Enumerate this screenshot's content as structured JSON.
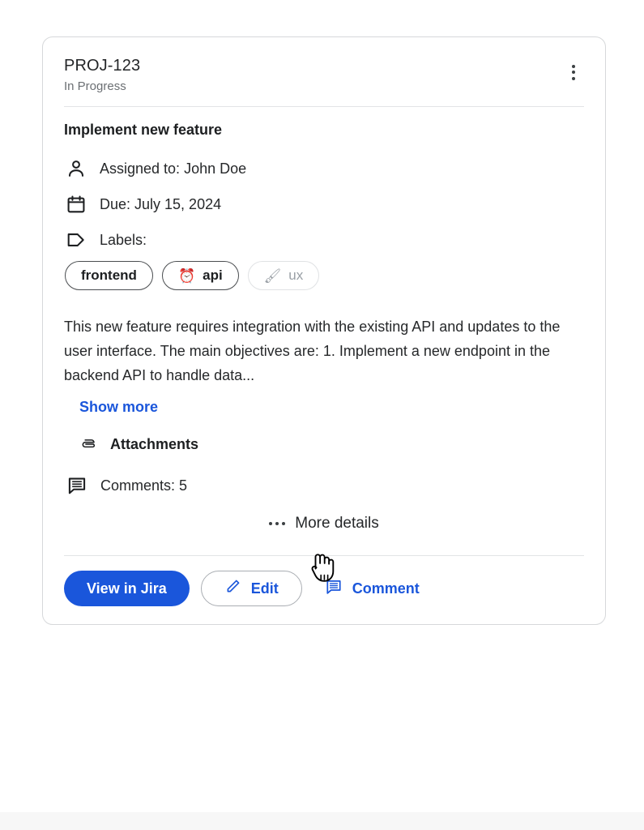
{
  "card": {
    "issue_key": "PROJ-123",
    "status": "In Progress",
    "menu_icon": "kebab-menu-icon",
    "title": "Implement new feature",
    "meta": [
      {
        "icon": "person-icon",
        "text": "Assigned to: John Doe"
      },
      {
        "icon": "calendar-icon",
        "text": "Due: July 15, 2024"
      },
      {
        "icon": "tag-icon",
        "text": "Labels:"
      }
    ],
    "labels": [
      {
        "text": "frontend",
        "emoji": "",
        "muted": false
      },
      {
        "text": "api",
        "emoji": "⏰",
        "muted": false
      },
      {
        "text": "ux",
        "emoji": "🖌",
        "muted": true
      }
    ],
    "description": "This new feature requires integration with the existing API and updates to the user interface. The main objectives are: 1. Implement a new endpoint in the backend API to handle data...",
    "show_more": "Show more",
    "attachments": {
      "icon": "paperclip-icon",
      "label": "Attachments"
    },
    "comments": {
      "icon": "comment-icon",
      "label": "Comments: 5"
    },
    "more_details": {
      "icon": "ellipsis-icon",
      "label": "More details"
    },
    "footer": {
      "view_in_jira": "View in Jira",
      "edit": "Edit",
      "comment": "Comment"
    }
  },
  "colors": {
    "accent_blue": "#1a56db",
    "text_primary": "#1d1f21",
    "text_secondary": "#6b6f73",
    "border": "#d6d8da",
    "muted_chip": "#9aa0a6"
  }
}
